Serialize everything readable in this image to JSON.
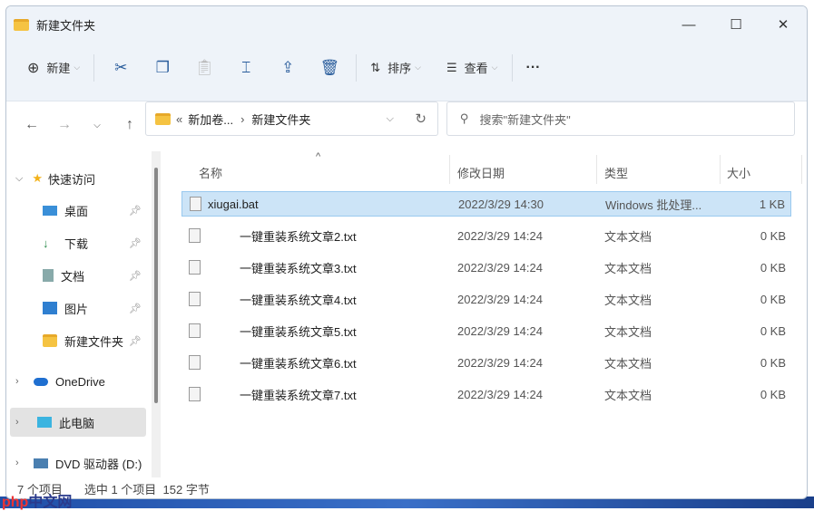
{
  "window": {
    "title": "新建文件夹",
    "minimize": "—",
    "maximize": "☐",
    "close": "✕"
  },
  "toolbar": {
    "new_label": "新建",
    "sort_label": "排序",
    "view_label": "查看",
    "more": "···"
  },
  "address": {
    "prefix": "«",
    "segments": [
      "新加卷...",
      "新建文件夹"
    ],
    "separator": "›"
  },
  "search": {
    "placeholder": "搜索\"新建文件夹\""
  },
  "sidebar": {
    "quick_access": "快速访问",
    "items": [
      {
        "label": "桌面"
      },
      {
        "label": "下载"
      },
      {
        "label": "文档"
      },
      {
        "label": "图片"
      },
      {
        "label": "新建文件夹"
      }
    ],
    "onedrive": "OneDrive",
    "this_pc": "此电脑",
    "dvd": "DVD 驱动器 (D:)"
  },
  "columns": {
    "name": "名称",
    "date": "修改日期",
    "type": "类型",
    "size": "大小"
  },
  "files": [
    {
      "name": "xiugai.bat",
      "date": "2022/3/29 14:30",
      "type": "Windows 批处理...",
      "size": "1 KB"
    },
    {
      "name": "一键重装系统文章2.txt",
      "date": "2022/3/29 14:24",
      "type": "文本文档",
      "size": "0 KB"
    },
    {
      "name": "一键重装系统文章3.txt",
      "date": "2022/3/29 14:24",
      "type": "文本文档",
      "size": "0 KB"
    },
    {
      "name": "一键重装系统文章4.txt",
      "date": "2022/3/29 14:24",
      "type": "文本文档",
      "size": "0 KB"
    },
    {
      "name": "一键重装系统文章5.txt",
      "date": "2022/3/29 14:24",
      "type": "文本文档",
      "size": "0 KB"
    },
    {
      "name": "一键重装系统文章6.txt",
      "date": "2022/3/29 14:24",
      "type": "文本文档",
      "size": "0 KB"
    },
    {
      "name": "一键重装系统文章7.txt",
      "date": "2022/3/29 14:24",
      "type": "文本文档",
      "size": "0 KB"
    }
  ],
  "status": {
    "count": "7 个项目",
    "selection": "选中 1 个项目  152 字节"
  },
  "watermark": {
    "a": "php",
    "b": "中文网"
  }
}
